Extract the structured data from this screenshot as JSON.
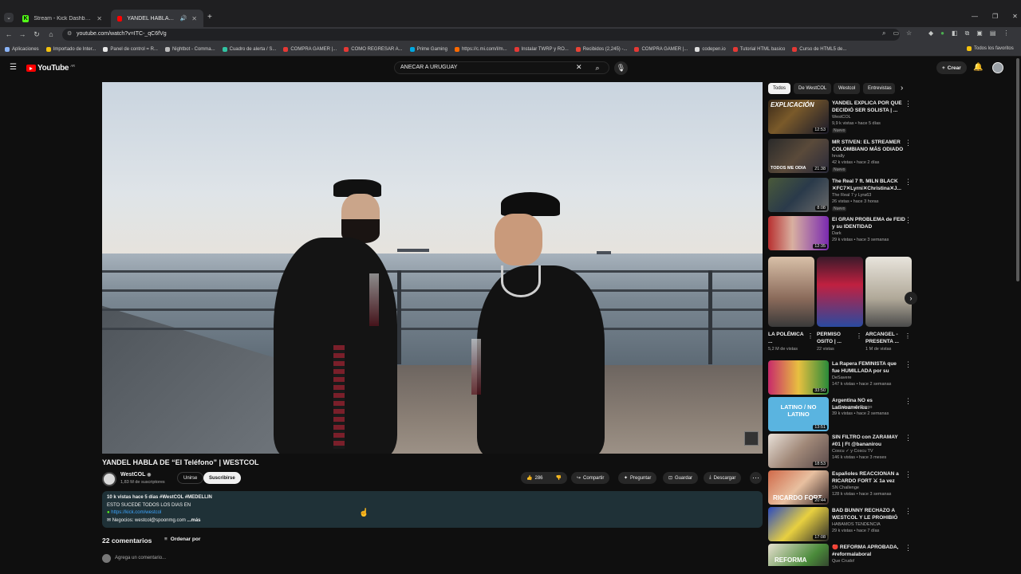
{
  "browser": {
    "tabs": [
      {
        "label": "Stream - Kick Dashboard"
      },
      {
        "label": "YANDEL HABLA DE \"El Teléfo"
      }
    ],
    "url": "youtube.com/watch?v=ITC-_qC6fVg",
    "bookmarks": [
      "Aplicaciones",
      "Importado de Inter...",
      "Panel de control = R...",
      "Nightbot - Comma...",
      "Cuadro de alerta / S...",
      "COMPRA GAMER |...",
      "COMO REGRESAR A...",
      "Prime Gaming",
      "https://c.mi.com/l/m...",
      "Instalar TWRP y RO...",
      "Recibidos (2,245) -...",
      "COMPRA GAMER |...",
      "codepen.io",
      "Tutorial HTML basico",
      "Curso de HTML5 de..."
    ],
    "all_favorites": "Todos los favoritos"
  },
  "youtube": {
    "logo": "YouTube",
    "country": "AR",
    "search_value": "ANECAR A URUGUAY",
    "create_label": "Crear"
  },
  "video": {
    "title": "YANDEL HABLA DE “El Teléfono” | WESTCOL",
    "channel": "WestCOL",
    "subscribers": "1,83 M de suscriptores",
    "join_label": "Unirse",
    "subscribe_label": "Suscribirse",
    "likes": "286",
    "share_label": "Compartir",
    "ask_label": "Preguntar",
    "save_label": "Guardar",
    "download_label": "Descargar",
    "desc_line1": "10 k vistas  hace 5 días  #WestCOL #MEDELLIN",
    "desc_line2": "ESTO SUCEDE TODOS LOS DIAS EN",
    "desc_link": "https://kick.com/westcol",
    "desc_line4": "✉ Negocios: westcol@spoonmg.com",
    "desc_more": "...más",
    "comments_count": "22 comentarios",
    "sort_label": "Ordenar por",
    "add_comment_placeholder": "Agrega un comentario..."
  },
  "sidebar": {
    "chips": [
      "Todos",
      "De WestCOL",
      "Westcol",
      "Entrevistas"
    ],
    "videos_top": [
      {
        "title": "YANDEL EXPLICA POR QUÉ DECIDIÓ SER SOLISTA | ...",
        "channel": "WestCOL",
        "meta": "9,9 k vistas • hace 5 días",
        "badge": "Nuevo",
        "duration": "12:53",
        "thumb_text": "EXPLICACIÓN"
      },
      {
        "title": "MR STIVEN: EL STREAMER COLOMBIANO MÁS ODIADO",
        "channel": "hrvally",
        "meta": "42 k vistas • hace 2 días",
        "badge": "Nuevo",
        "duration": "21:38",
        "thumb_text": "TODOS ME ODIA"
      },
      {
        "title": "The Real 7 ft. MILN BLACK ✕FC7✕Lyrni✕Christina✕J...",
        "channel": "The Real 7 y Lyra63",
        "meta": "26 vistas • hace 3 horas",
        "badge": "Nuevo",
        "duration": "8:08",
        "thumb_text": ""
      },
      {
        "title": "El GRAN PROBLEMA de FEID y su IDENTIDAD",
        "channel": "Dark",
        "meta": "29 k vistas • hace 3 semanas",
        "badge": "",
        "duration": "12:35",
        "thumb_text": ""
      }
    ],
    "shorts": [
      {
        "title": "LA POLÉMICA ...",
        "views": "5,2 M de vistas"
      },
      {
        "title": "PERMISO OSITO | ...",
        "views": "22 vistas"
      },
      {
        "title": "ARCANGEL - PRESENTA ...",
        "views": "1 M de vistas"
      }
    ],
    "videos_bottom": [
      {
        "title": "La Rapera FEMINISTA que fue HUMILLADA por su discurso",
        "channel": "DeSavere",
        "meta": "147 k vistas • hace 2 semanas",
        "duration": "33:50",
        "thumb_text": ""
      },
      {
        "title": "Argentina NO es Latinoamérica",
        "channel": "La Cabeza de Sergo",
        "meta": "39 k vistas • hace 2 semanas",
        "duration": "13:51",
        "thumb_text": "LATINO / NO LATINO"
      },
      {
        "title": "SIN FILTRO con ZARAMAY #01 | Ft @bananirou",
        "channel": "Coscu ✓ y Coscu TV",
        "meta": "146 k vistas • hace 3 meses",
        "duration": "18:53",
        "thumb_text": ""
      },
      {
        "title": "Españoles REACCIONAN a RICARDO FORT ⚔ 1a vez",
        "channel": "SN Challenge",
        "meta": "128 k vistas • hace 3 semanas",
        "duration": "20:44",
        "thumb_text": "RICARDO FORT"
      },
      {
        "title": "BAD BUNNY RECHAZÓ A WESTCOL Y LE PROHIBIÓ EL ...",
        "channel": "HABAMOS TENDENCIA",
        "meta": "29 k vistas • hace 7 días",
        "duration": "17:08",
        "thumb_text": ""
      },
      {
        "title": "🔴 REFORMA APROBADA, #reformalaboral",
        "channel": "Que Crudo!",
        "meta": "",
        "duration": "",
        "thumb_text": "REFORMA"
      }
    ]
  },
  "colors": {
    "yt_red": "#ff0000",
    "kick_green": "#53fc18",
    "desc_bg": "#1f3137"
  }
}
